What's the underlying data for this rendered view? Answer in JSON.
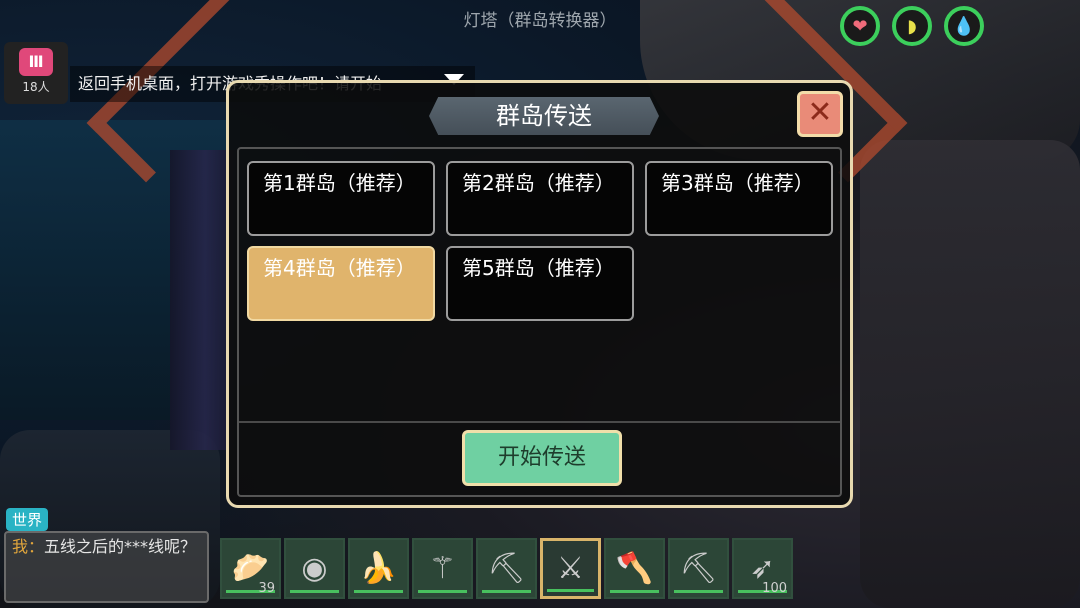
{
  "scene": {
    "location_title": "灯塔（群岛转换器）"
  },
  "status_bar": {
    "icons": [
      {
        "name": "heart-icon",
        "glyph": "❤",
        "color": "#f06b7a"
      },
      {
        "name": "banana-icon",
        "glyph": "◗",
        "color": "#e8e04a"
      },
      {
        "name": "water-drop-icon",
        "glyph": "💧",
        "color": "#2ec7d6"
      }
    ],
    "ring_color": "#3ccf5c"
  },
  "chat_header": {
    "logo_glyph": "Ⅲ",
    "member_count": "18人",
    "notice": "返回手机桌面，打开游戏秀操作吧！请开始"
  },
  "dialog": {
    "title": "群岛传送",
    "close_label": "✕",
    "islands": [
      {
        "label": "第1群岛（推荐）",
        "selected": false
      },
      {
        "label": "第2群岛（推荐）",
        "selected": false
      },
      {
        "label": "第3群岛（推荐）",
        "selected": false
      },
      {
        "label": "第4群岛（推荐）",
        "selected": true
      },
      {
        "label": "第5群岛（推荐）",
        "selected": false
      }
    ],
    "start_label": "开始传送",
    "selected_color": "#e0b46c"
  },
  "chat": {
    "channel": "世界",
    "speaker": "我",
    "separator": "：",
    "message": "五线之后的***线呢？"
  },
  "hotbar": {
    "slots": [
      {
        "item": "steamed-bun-basket-icon",
        "glyph": "🥟",
        "count": "39"
      },
      {
        "item": "disc-icon",
        "glyph": "◉",
        "count": ""
      },
      {
        "item": "banana-icon",
        "glyph": "🍌",
        "count": ""
      },
      {
        "item": "blue-staff-icon",
        "glyph": "⚚",
        "count": ""
      },
      {
        "item": "pickaxe-icon",
        "glyph": "⛏",
        "count": ""
      },
      {
        "item": "crystal-sword-icon",
        "glyph": "⚔",
        "count": "",
        "selected": true
      },
      {
        "item": "crystal-axe-icon",
        "glyph": "🪓",
        "count": ""
      },
      {
        "item": "crystal-pickaxe-icon",
        "glyph": "⛏",
        "count": ""
      },
      {
        "item": "arrows-icon",
        "glyph": "➶",
        "count": "100"
      }
    ]
  }
}
